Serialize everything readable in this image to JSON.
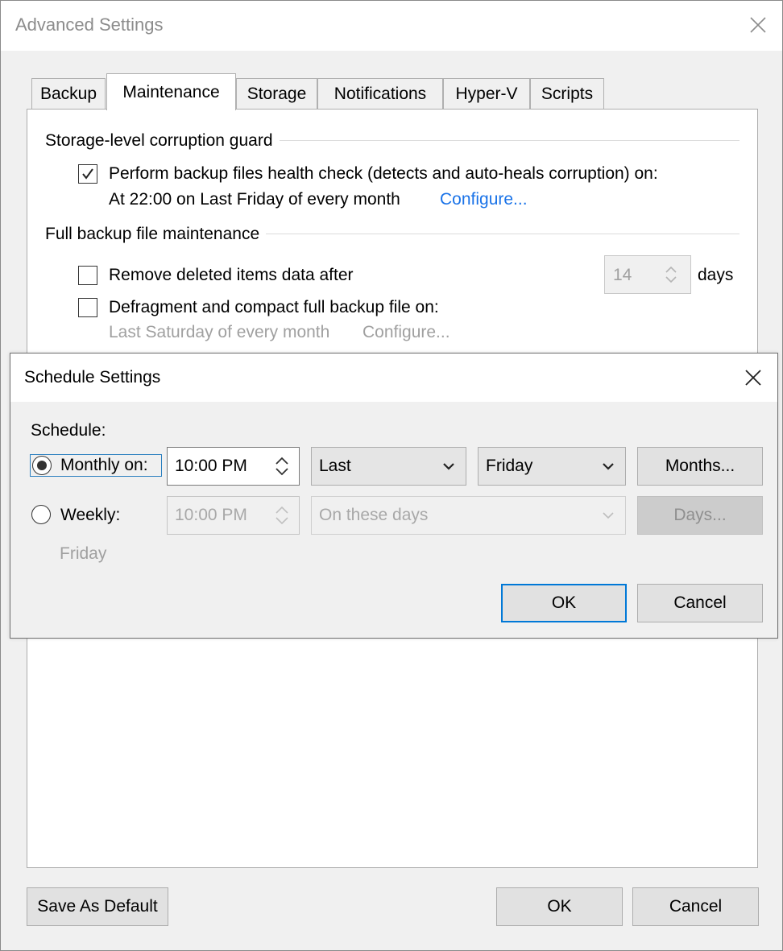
{
  "window": {
    "title": "Advanced Settings",
    "close_icon": "close-icon"
  },
  "tabs": [
    {
      "label": "Backup",
      "active": false
    },
    {
      "label": "Maintenance",
      "active": true
    },
    {
      "label": "Storage",
      "active": false
    },
    {
      "label": "Notifications",
      "active": false
    },
    {
      "label": "Hyper-V",
      "active": false
    },
    {
      "label": "Scripts",
      "active": false
    }
  ],
  "maintenance": {
    "corruption_guard": {
      "group_label": "Storage-level corruption guard",
      "health_check": {
        "label": "Perform backup files health check (detects and auto-heals corruption) on:",
        "checked": true,
        "schedule_text": "At 22:00 on Last Friday of every month",
        "configure_link": "Configure..."
      }
    },
    "full_backup": {
      "group_label": "Full backup file maintenance",
      "remove_deleted": {
        "label": "Remove deleted items data after",
        "checked": false,
        "value": "14",
        "unit": "days"
      },
      "defragment": {
        "label": "Defragment and compact full backup file on:",
        "checked": false,
        "schedule_text": "Last Saturday of every month",
        "configure_link": "Configure..."
      }
    }
  },
  "footer": {
    "save_default": "Save As Default",
    "ok": "OK",
    "cancel": "Cancel"
  },
  "schedule_dialog": {
    "title": "Schedule Settings",
    "schedule_label": "Schedule:",
    "monthly": {
      "label": "Monthly on:",
      "selected": true,
      "time": "10:00 PM",
      "occurrence": "Last",
      "day": "Friday",
      "months_button": "Months..."
    },
    "weekly": {
      "label": "Weekly:",
      "selected": false,
      "time": "10:00 PM",
      "days_option": "On these days",
      "days_button": "Days...",
      "summary": "Friday"
    },
    "ok": "OK",
    "cancel": "Cancel"
  }
}
